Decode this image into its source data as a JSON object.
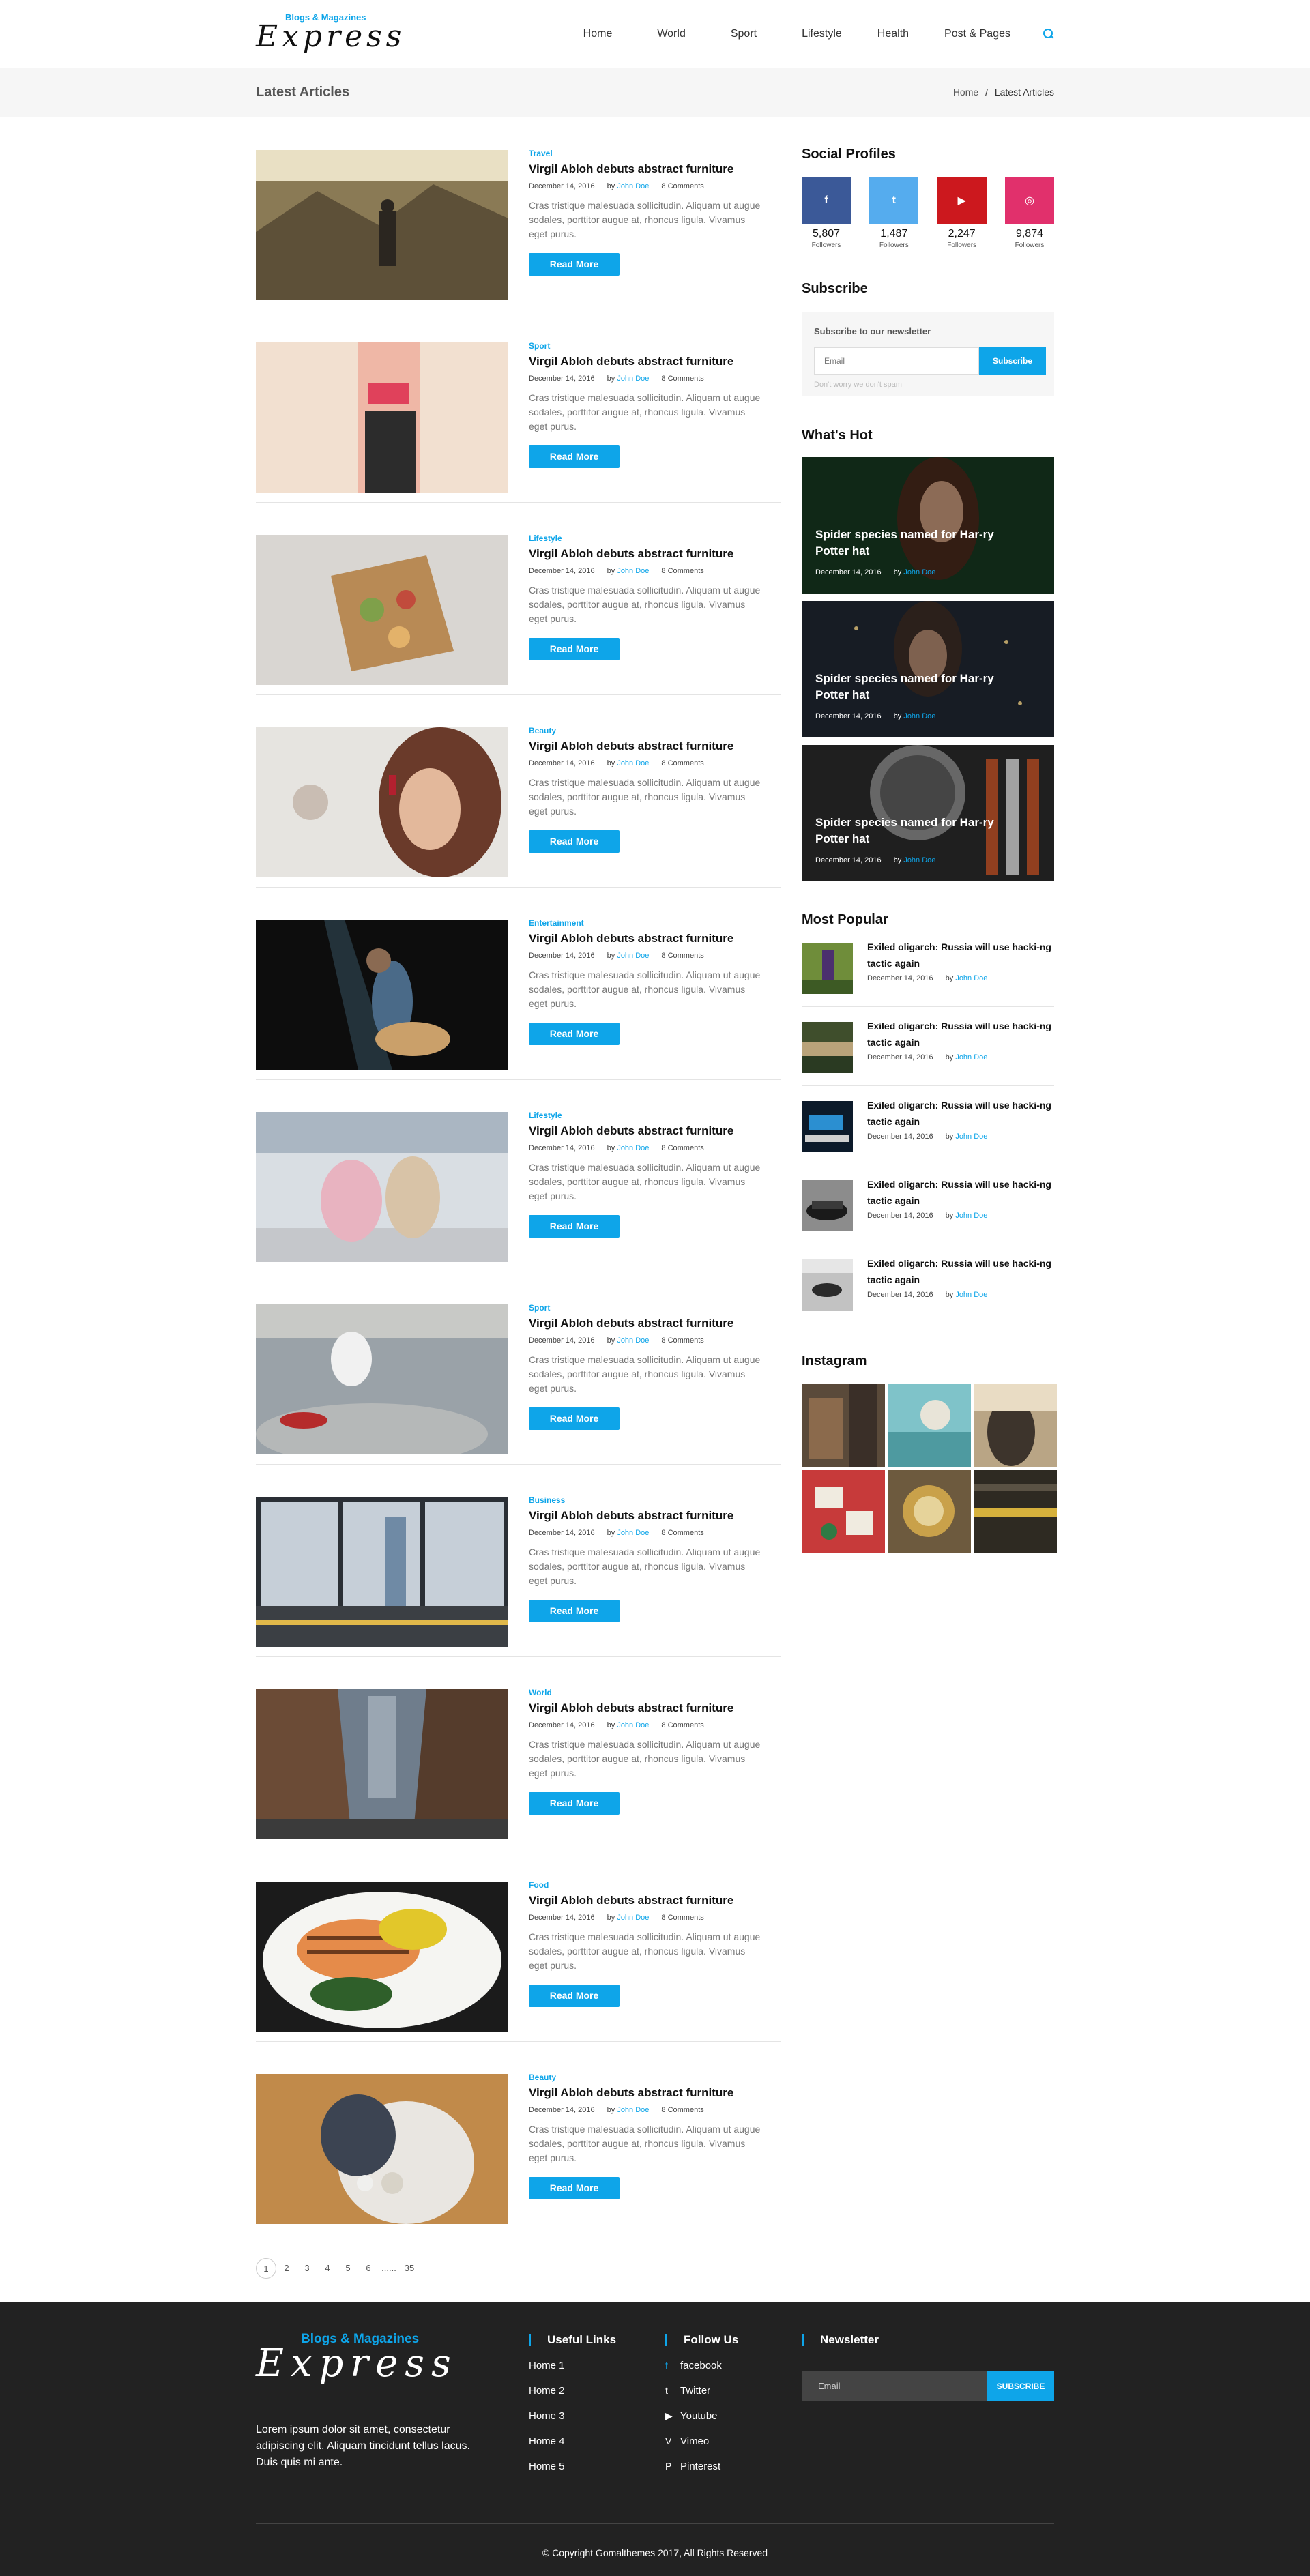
{
  "header": {
    "logo_tag": "Blogs & Magazines",
    "logo_script": "Express",
    "nav": [
      "Home",
      "World",
      "Sport",
      "Lifestyle",
      "Health",
      "Post & Pages"
    ],
    "search_icon": "search-icon"
  },
  "titlebar": {
    "title": "Latest Articles",
    "crumb_home": "Home",
    "crumb_sep": "/",
    "crumb_current": "Latest Articles"
  },
  "articles": [
    {
      "category": "Travel",
      "title": "Virgil Abloh debuts abstract furniture",
      "date": "December 14, 2016",
      "by": "by",
      "author": "John Doe",
      "comments": "8 Comments",
      "excerpt": "Cras tristique malesuada sollicitudin. Aliquam ut augue sodales, porttitor augue at, rhoncus ligula. Vivamus eget purus.",
      "button": "Read More"
    },
    {
      "category": "Sport",
      "title": "Virgil Abloh debuts abstract furniture",
      "date": "December 14, 2016",
      "by": "by",
      "author": "John Doe",
      "comments": "8 Comments",
      "excerpt": "Cras tristique malesuada sollicitudin. Aliquam ut augue sodales, porttitor augue at, rhoncus ligula. Vivamus eget purus.",
      "button": "Read More"
    },
    {
      "category": "Lifestyle",
      "title": "Virgil Abloh debuts abstract furniture",
      "date": "December 14, 2016",
      "by": "by",
      "author": "John Doe",
      "comments": "8 Comments",
      "excerpt": "Cras tristique malesuada sollicitudin. Aliquam ut augue sodales, porttitor augue at, rhoncus ligula. Vivamus eget purus.",
      "button": "Read More"
    },
    {
      "category": "Beauty",
      "title": "Virgil Abloh debuts abstract furniture",
      "date": "December 14, 2016",
      "by": "by",
      "author": "John Doe",
      "comments": "8 Comments",
      "excerpt": "Cras tristique malesuada sollicitudin. Aliquam ut augue sodales, porttitor augue at, rhoncus ligula. Vivamus eget purus.",
      "button": "Read More"
    },
    {
      "category": "Entertainment",
      "title": "Virgil Abloh debuts abstract furniture",
      "date": "December 14, 2016",
      "by": "by",
      "author": "John Doe",
      "comments": "8 Comments",
      "excerpt": "Cras tristique malesuada sollicitudin. Aliquam ut augue sodales, porttitor augue at, rhoncus ligula. Vivamus eget purus.",
      "button": "Read More"
    },
    {
      "category": "Lifestyle",
      "title": "Virgil Abloh debuts abstract furniture",
      "date": "December 14, 2016",
      "by": "by",
      "author": "John Doe",
      "comments": "8 Comments",
      "excerpt": "Cras tristique malesuada sollicitudin. Aliquam ut augue sodales, porttitor augue at, rhoncus ligula. Vivamus eget purus.",
      "button": "Read More"
    },
    {
      "category": "Sport",
      "title": "Virgil Abloh debuts abstract furniture",
      "date": "December 14, 2016",
      "by": "by",
      "author": "John Doe",
      "comments": "8 Comments",
      "excerpt": "Cras tristique malesuada sollicitudin. Aliquam ut augue sodales, porttitor augue at, rhoncus ligula. Vivamus eget purus.",
      "button": "Read More"
    },
    {
      "category": "Business",
      "title": "Virgil Abloh debuts abstract furniture",
      "date": "December 14, 2016",
      "by": "by",
      "author": "John Doe",
      "comments": "8 Comments",
      "excerpt": "Cras tristique malesuada sollicitudin. Aliquam ut augue sodales, porttitor augue at, rhoncus ligula. Vivamus eget purus.",
      "button": "Read More"
    },
    {
      "category": "World",
      "title": "Virgil Abloh debuts abstract furniture",
      "date": "December 14, 2016",
      "by": "by",
      "author": "John Doe",
      "comments": "8 Comments",
      "excerpt": "Cras tristique malesuada sollicitudin. Aliquam ut augue sodales, porttitor augue at, rhoncus ligula. Vivamus eget purus.",
      "button": "Read More"
    },
    {
      "category": "Food",
      "title": "Virgil Abloh debuts abstract furniture",
      "date": "December 14, 2016",
      "by": "by",
      "author": "John Doe",
      "comments": "8 Comments",
      "excerpt": "Cras tristique malesuada sollicitudin. Aliquam ut augue sodales, porttitor augue at, rhoncus ligula. Vivamus eget purus.",
      "button": "Read More"
    },
    {
      "category": "Beauty",
      "title": "Virgil Abloh debuts abstract furniture",
      "date": "December 14, 2016",
      "by": "by",
      "author": "John Doe",
      "comments": "8 Comments",
      "excerpt": "Cras tristique malesuada sollicitudin. Aliquam ut augue sodales, porttitor augue at, rhoncus ligula. Vivamus eget purus.",
      "button": "Read More"
    }
  ],
  "pagination": [
    "1",
    "2",
    "3",
    "4",
    "5",
    "6",
    "......",
    "35"
  ],
  "sidebar": {
    "social_title": "Social Profiles",
    "socials": [
      {
        "icon": "facebook-icon",
        "glyph": "f",
        "count": "5,807",
        "label": "Followers",
        "color": "#3b5998"
      },
      {
        "icon": "twitter-icon",
        "glyph": "t",
        "count": "1,487",
        "label": "Followers",
        "color": "#55acee"
      },
      {
        "icon": "youtube-icon",
        "glyph": "▶",
        "count": "2,247",
        "label": "Followers",
        "color": "#cc181e"
      },
      {
        "icon": "instagram-icon",
        "glyph": "◎",
        "count": "9,874",
        "label": "Followers",
        "color": "#e1306c"
      }
    ],
    "subscribe_title": "Subscribe",
    "subscribe_heading": "Subscribe to our newsletter",
    "subscribe_placeholder": "Email",
    "subscribe_button": "Subscribe",
    "subscribe_note": "Don't worry we don't spam",
    "hot_title": "What's Hot",
    "hot": [
      {
        "title": "Spider species named for Har-ry Potter hat",
        "date": "December 14, 2016",
        "by": "by",
        "author": "John Doe"
      },
      {
        "title": "Spider species named for Har-ry Potter hat",
        "date": "December 14, 2016",
        "by": "by",
        "author": "John Doe"
      },
      {
        "title": "Spider species named for Har-ry Potter hat",
        "date": "December 14, 2016",
        "by": "by",
        "author": "John Doe"
      }
    ],
    "popular_title": "Most Popular",
    "popular": [
      {
        "title": "Exiled oligarch: Russia will use hacki-ng tactic again",
        "date": "December 14, 2016",
        "by": "by",
        "author": "John Doe"
      },
      {
        "title": "Exiled oligarch: Russia will use hacki-ng tactic again",
        "date": "December 14, 2016",
        "by": "by",
        "author": "John Doe"
      },
      {
        "title": "Exiled oligarch: Russia will use hacki-ng tactic again",
        "date": "December 14, 2016",
        "by": "by",
        "author": "John Doe"
      },
      {
        "title": "Exiled oligarch: Russia will use hacki-ng tactic again",
        "date": "December 14, 2016",
        "by": "by",
        "author": "John Doe"
      },
      {
        "title": "Exiled oligarch: Russia will use hacki-ng tactic again",
        "date": "December 14, 2016",
        "by": "by",
        "author": "John Doe"
      }
    ],
    "instagram_title": "Instagram"
  },
  "footer": {
    "logo_tag": "Blogs & Magazines",
    "logo_script": "Express",
    "about": "Lorem ipsum dolor sit amet, consectetur adipiscing elit. Aliquam tincidunt tellus lacus. Duis quis mi ante.",
    "links_title": "Useful Links",
    "links": [
      "Home 1",
      "Home 2",
      "Home 3",
      "Home 4",
      "Home 5"
    ],
    "follow_title": "Follow Us",
    "follow": [
      {
        "icon": "facebook-icon",
        "glyph": "f",
        "label": "facebook"
      },
      {
        "icon": "twitter-icon",
        "glyph": "t",
        "label": "Twitter"
      },
      {
        "icon": "youtube-icon",
        "glyph": "▶",
        "label": "Youtube"
      },
      {
        "icon": "vimeo-icon",
        "glyph": "V",
        "label": "Vimeo"
      },
      {
        "icon": "pinterest-icon",
        "glyph": "P",
        "label": "Pinterest"
      }
    ],
    "newsletter_title": "Newsletter",
    "newsletter_placeholder": "Email",
    "newsletter_button": "SUBSCRIBE",
    "copyright": "© Copyright Gomalthemes 2017, All Rights Reserved"
  },
  "colors": {
    "accent": "#0ea5e9",
    "footer_bg": "#222222",
    "titlebar_bg": "#f6f6f6"
  }
}
